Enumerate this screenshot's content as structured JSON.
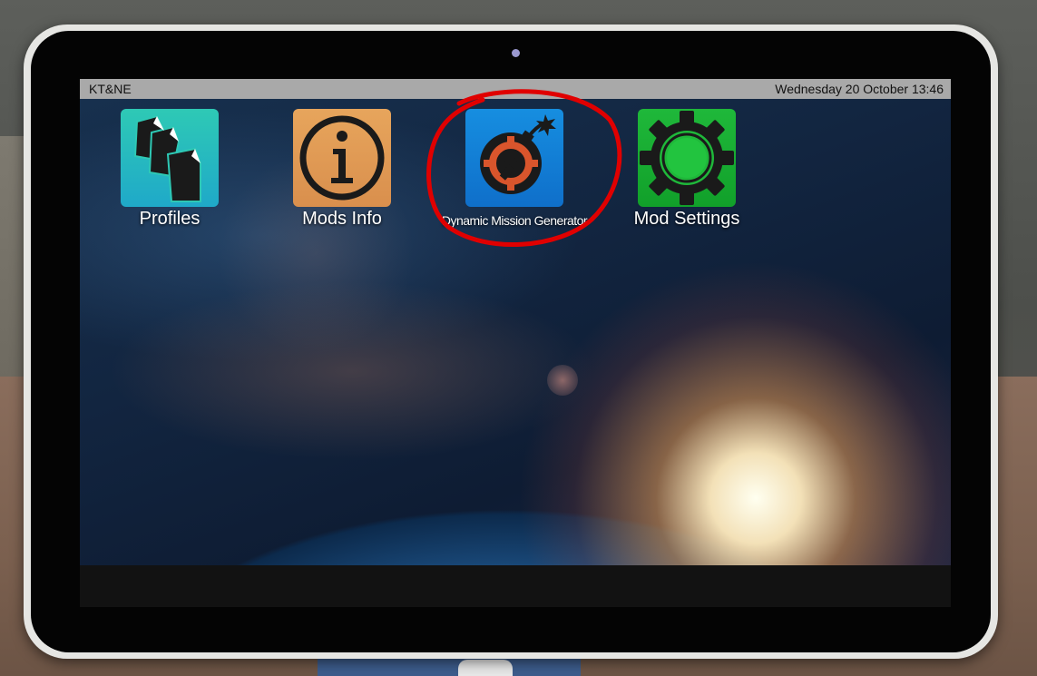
{
  "statusbar": {
    "app_name": "KT&NE",
    "datetime": "Wednesday 20 October 13:46"
  },
  "apps": [
    {
      "label": "Profiles",
      "icon": "profiles-icon"
    },
    {
      "label": "Mods Info",
      "icon": "info-icon"
    },
    {
      "label": "Dynamic Mission Generator",
      "icon": "bomb-icon"
    },
    {
      "label": "Mod Settings",
      "icon": "gear-icon"
    }
  ],
  "colors": {
    "highlight": "#e00000",
    "statusbar": "#a9a9a9",
    "profiles_tile": "#2ec9b5",
    "info_tile": "#e7a55c",
    "dmg_tile": "#168ee0",
    "settings_tile": "#1fb83a"
  }
}
